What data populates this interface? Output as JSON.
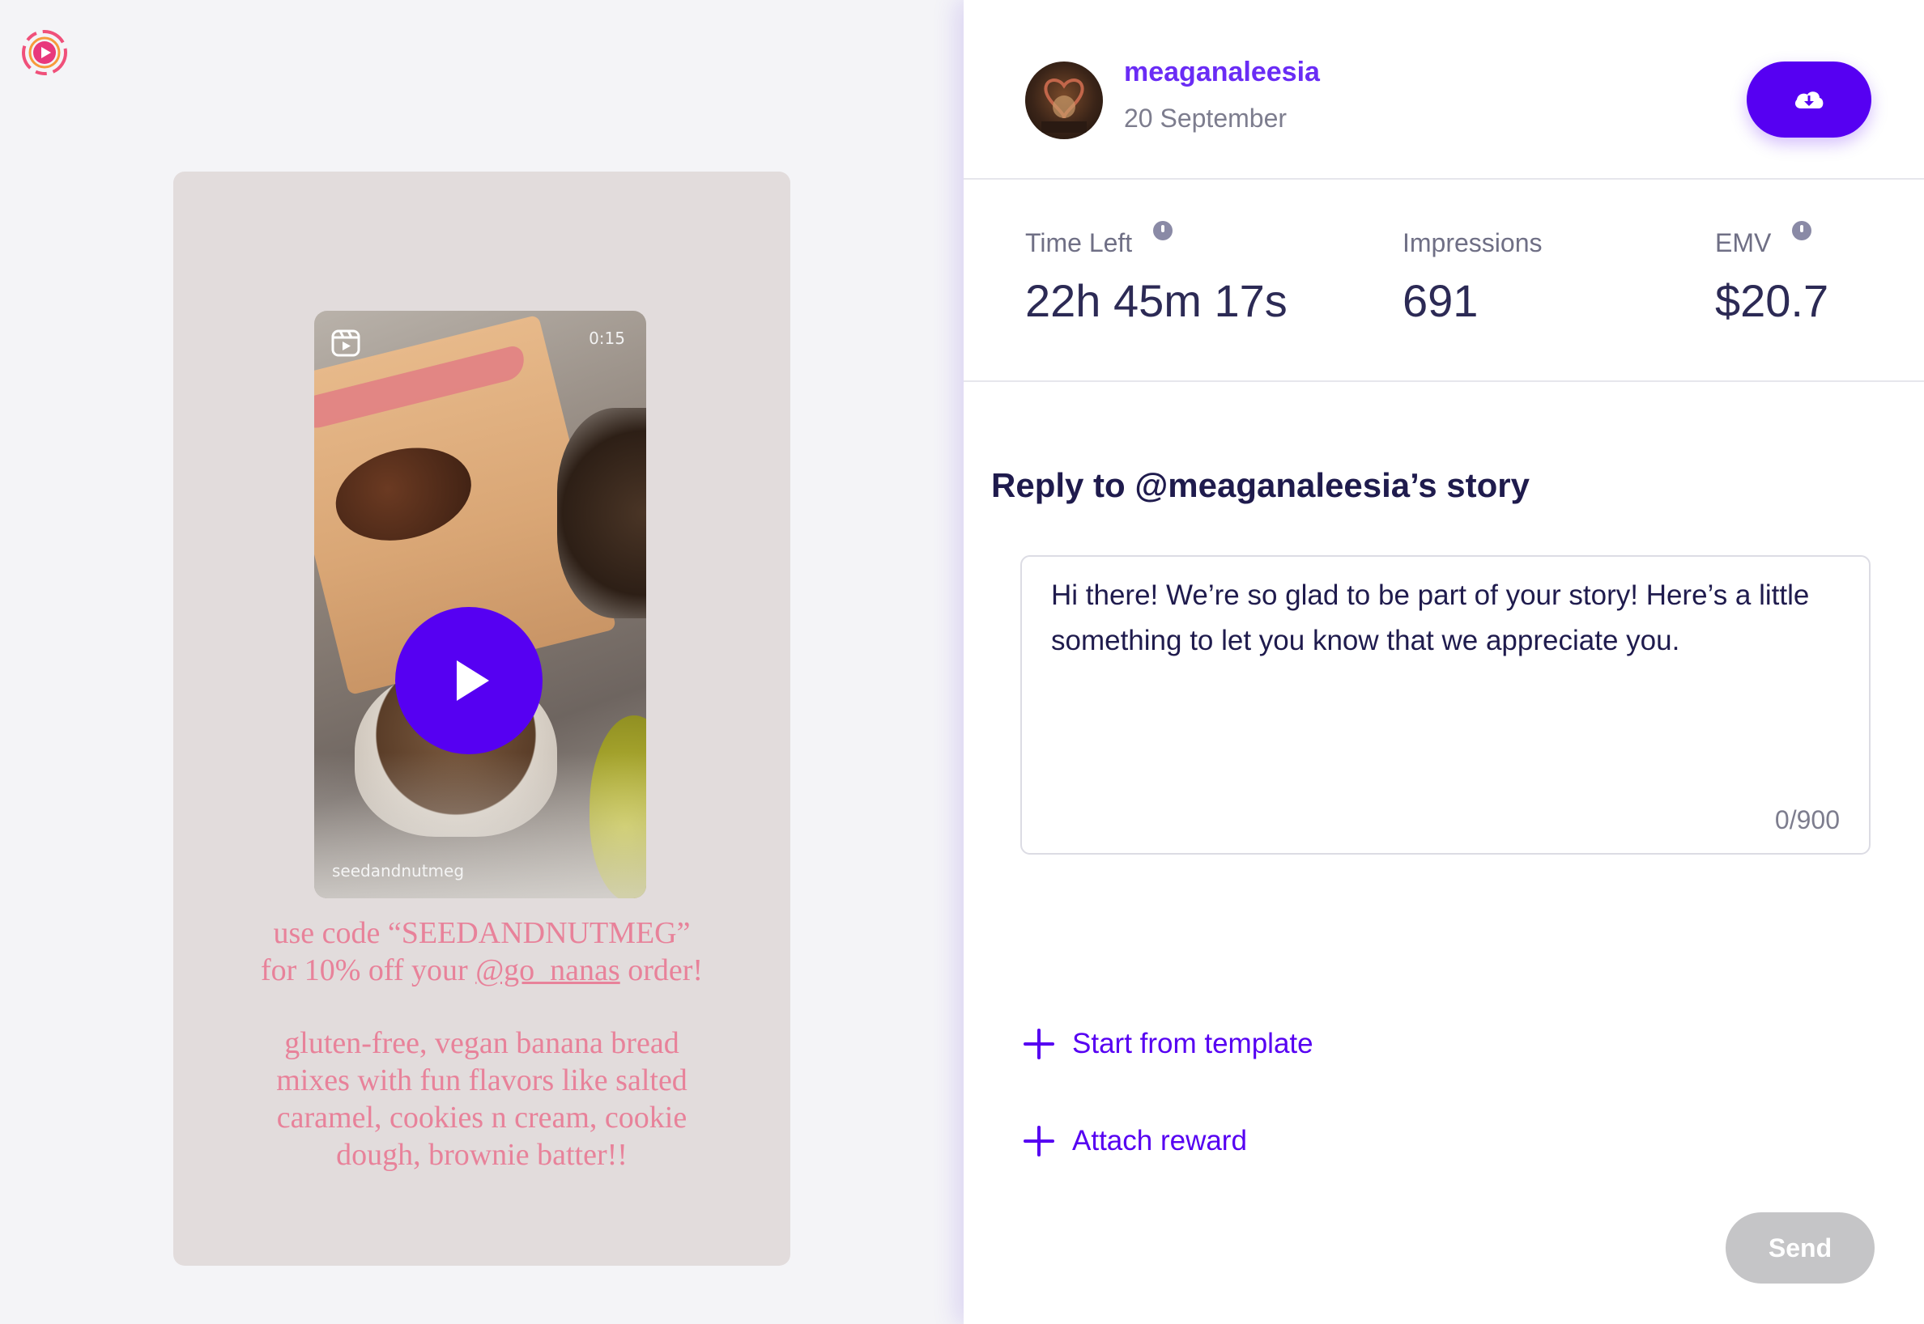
{
  "app": {
    "logo_icon": "app-logo-icon",
    "accent_color": "#5600f2"
  },
  "story": {
    "video": {
      "duration": "0:15",
      "handle": "seedandnutmeg",
      "reels_icon": "reels-icon",
      "play_icon": "play-icon"
    },
    "caption": {
      "line1": "use code “SEEDANDNUTMEG”",
      "line2_prefix": "for 10% off your ",
      "line2_mention": "@go_nanas",
      "line2_suffix": " order!",
      "line3": "gluten-free, vegan banana bread",
      "line4": "mixes with fun flavors like salted",
      "line5": "caramel, cookies n cream, cookie",
      "line6": "dough, brownie batter!!"
    }
  },
  "header": {
    "username": "meaganaleesia",
    "date": "20 September",
    "download_icon": "cloud-download-icon"
  },
  "stats": {
    "time_left": {
      "label": "Time Left",
      "value": "22h 45m 17s"
    },
    "impressions": {
      "label": "Impressions",
      "value": "691"
    },
    "emv": {
      "label": "EMV",
      "value": "$20.7"
    }
  },
  "reply": {
    "title": "Reply to @meaganaleesia’s story",
    "message": "Hi there! We’re so glad to be part of your story! Here’s a little something to let you know that we appreciate you.",
    "char_count": "0/900",
    "start_template_label": "Start from template",
    "attach_reward_label": "Attach reward",
    "send_label": "Send"
  }
}
